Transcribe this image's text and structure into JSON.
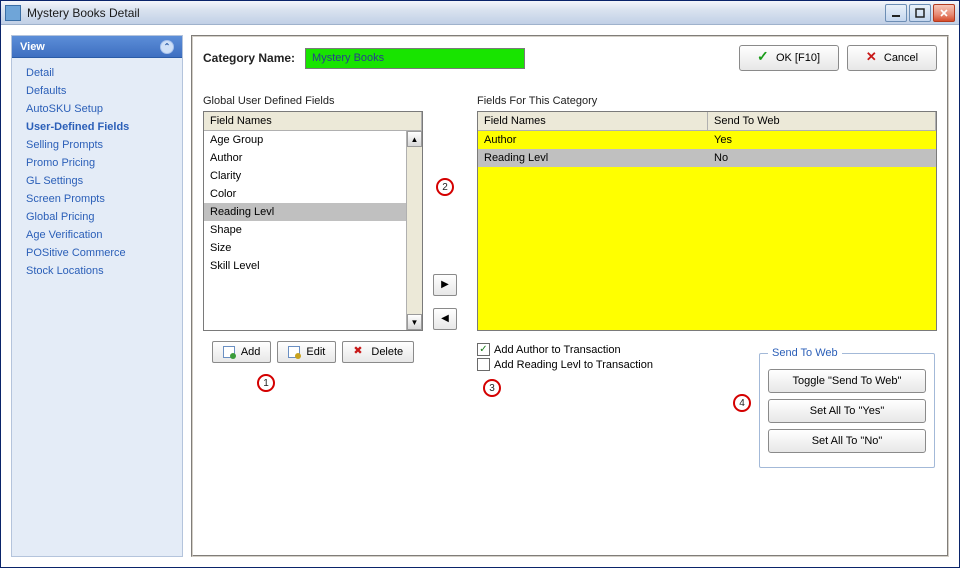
{
  "window": {
    "title": "Mystery Books Detail"
  },
  "sidebar": {
    "header": "View",
    "items": [
      {
        "label": "Detail"
      },
      {
        "label": "Defaults"
      },
      {
        "label": "AutoSKU Setup"
      },
      {
        "label": "User-Defined Fields"
      },
      {
        "label": "Selling Prompts"
      },
      {
        "label": "Promo Pricing"
      },
      {
        "label": "GL Settings"
      },
      {
        "label": "Screen Prompts"
      },
      {
        "label": "Global Pricing"
      },
      {
        "label": "Age Verification"
      },
      {
        "label": "POSitive Commerce"
      },
      {
        "label": "Stock Locations"
      }
    ],
    "active_index": 3
  },
  "header": {
    "category_label": "Category Name:",
    "category_value": "Mystery Books",
    "ok_label": "OK [F10]",
    "cancel_label": "Cancel"
  },
  "global_fields": {
    "title": "Global User Defined Fields",
    "header": "Field Names",
    "items": [
      "Age Group",
      "Author",
      "Clarity",
      "Color",
      "Reading Levl",
      "Shape",
      "Size",
      "Skill Level"
    ],
    "selected_index": 4,
    "add_label": "Add",
    "edit_label": "Edit",
    "delete_label": "Delete"
  },
  "category_fields": {
    "title": "Fields For This Category",
    "header1": "Field Names",
    "header2": "Send To Web",
    "rows": [
      {
        "name": "Author",
        "send": "Yes",
        "selected": false
      },
      {
        "name": "Reading Levl",
        "send": "No",
        "selected": true
      }
    ]
  },
  "checkboxes": {
    "add_author": {
      "label": "Add Author to Transaction",
      "checked": true
    },
    "add_reading": {
      "label": "Add Reading Levl to Transaction",
      "checked": false
    }
  },
  "send_to_web": {
    "legend": "Send To Web",
    "toggle": "Toggle \"Send To Web\"",
    "all_yes": "Set All To \"Yes\"",
    "all_no": "Set All To \"No\""
  },
  "markers": {
    "m1": "1",
    "m2": "2",
    "m3": "3",
    "m4": "4"
  }
}
